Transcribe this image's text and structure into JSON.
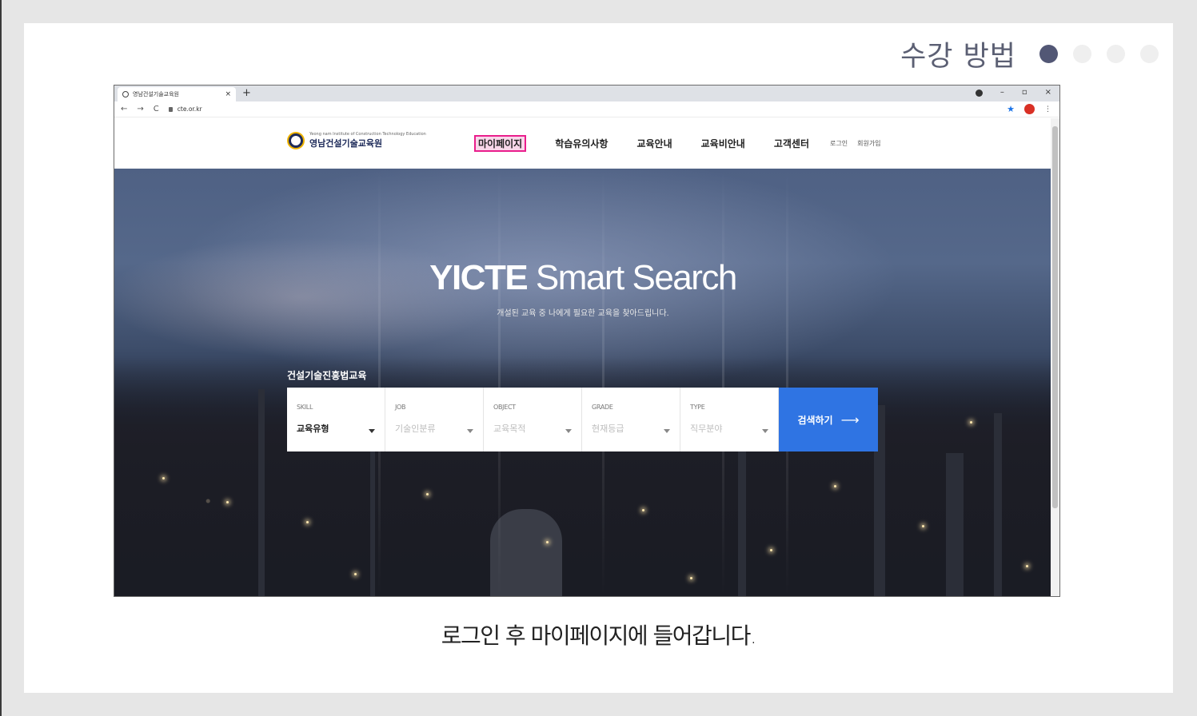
{
  "header": {
    "step_title": "수강 방법",
    "dots": [
      true,
      false,
      false,
      false
    ]
  },
  "browser": {
    "tab_title": "영남건설기술교육원",
    "tab_close": "×",
    "new_tab": "+",
    "url": "cte.or.kr",
    "win_minimize": "–",
    "win_restore": "▫",
    "win_close": "×"
  },
  "site": {
    "logo_sub": "Yeong nam Institute of Construction Technology Education",
    "logo_name": "영남건설기술교육원",
    "menu": {
      "mypage": "마이페이지",
      "notice": "학습유의사항",
      "edu_info": "교육안내",
      "fee_info": "교육비안내",
      "support": "고객센터",
      "login": "로그인",
      "signup": "회원가입"
    },
    "hero": {
      "title_bold": "YICTE",
      "title_light": " Smart Search",
      "subtitle": "개설된 교육 중 나에게 필요한 교육을 찾아드립니다.",
      "search_label": "건설기술진흥법교육",
      "fields": [
        {
          "label": "SKILL",
          "value": "교육유형"
        },
        {
          "label": "JOB",
          "value": "기술인분류"
        },
        {
          "label": "OBJECT",
          "value": "교육목적"
        },
        {
          "label": "GRADE",
          "value": "현재등급"
        },
        {
          "label": "TYPE",
          "value": "직무분야"
        }
      ],
      "search_button": "검색하기",
      "search_arrow": "⟶"
    }
  },
  "caption": "로그인 후 마이페이지에 들어갑니다."
}
